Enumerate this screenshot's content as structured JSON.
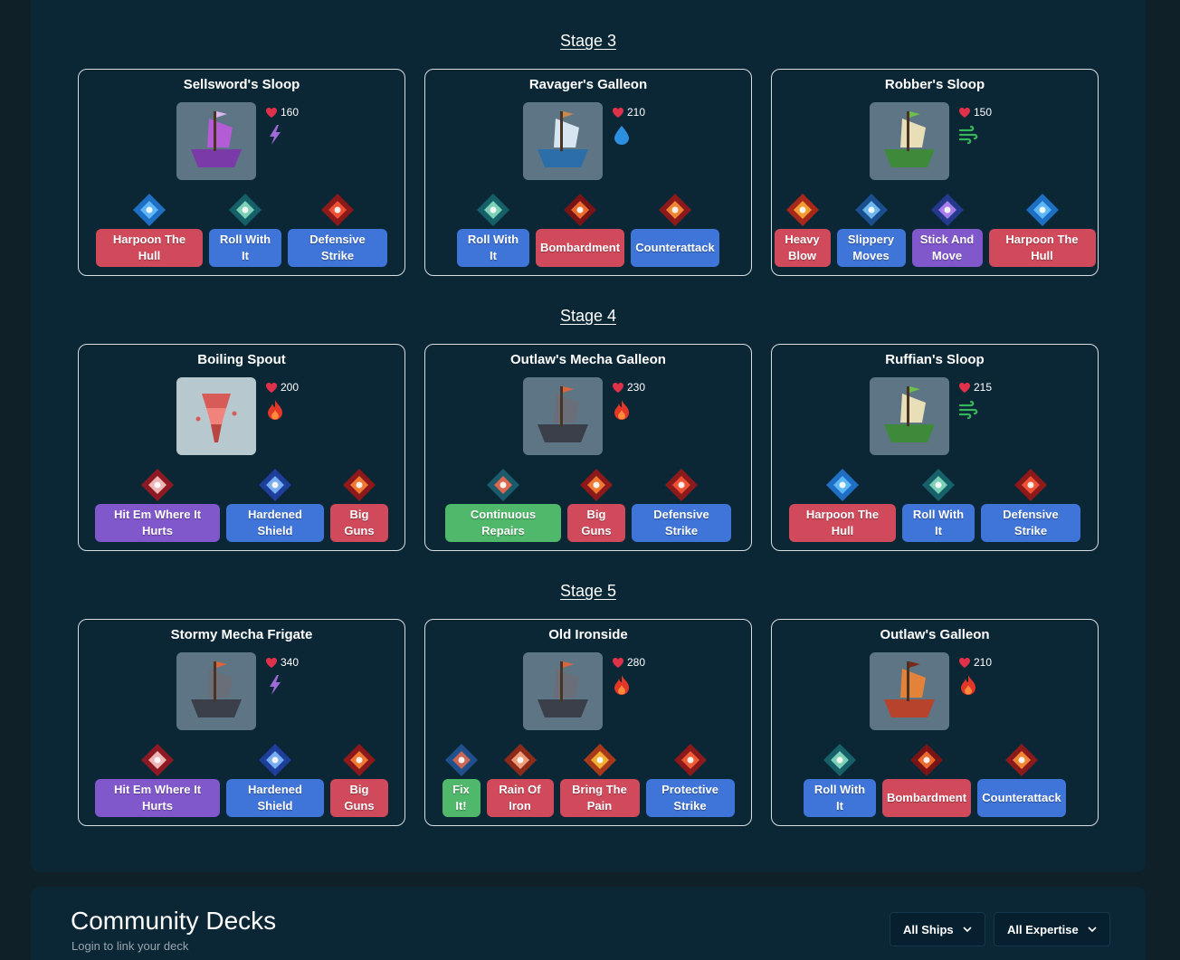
{
  "stages": [
    {
      "title": "Stage 3",
      "ships": [
        {
          "name": "Sellsword's Sloop",
          "hp": "160",
          "element": "lightning-icon",
          "theme": "purple",
          "skills": [
            {
              "label": "Harpoon The Hull",
              "color": "red",
              "icon": "harpoon-icon"
            },
            {
              "label": "Roll With It",
              "color": "blue",
              "icon": "roll-icon"
            },
            {
              "label": "Defensive Strike",
              "color": "blue",
              "icon": "defensive-strike-icon"
            }
          ]
        },
        {
          "name": "Ravager's Galleon",
          "hp": "210",
          "element": "water-icon",
          "theme": "blue",
          "skills": [
            {
              "label": "Roll With It",
              "color": "blue",
              "icon": "roll-icon"
            },
            {
              "label": "Bombardment",
              "color": "red",
              "icon": "bombardment-icon"
            },
            {
              "label": "Counterattack",
              "color": "blue",
              "icon": "counterattack-icon"
            }
          ]
        },
        {
          "name": "Robber's Sloop",
          "hp": "150",
          "element": "wind-icon",
          "theme": "green",
          "skills": [
            {
              "label": "Heavy Blow",
              "color": "red",
              "icon": "heavy-blow-icon"
            },
            {
              "label": "Slippery Moves",
              "color": "blue",
              "icon": "slippery-icon"
            },
            {
              "label": "Stick And Move",
              "color": "purple",
              "icon": "stick-move-icon"
            },
            {
              "label": "Harpoon The Hull",
              "color": "red",
              "icon": "harpoon-icon"
            }
          ]
        }
      ]
    },
    {
      "title": "Stage 4",
      "ships": [
        {
          "name": "Boiling Spout",
          "hp": "200",
          "element": "fire-icon",
          "theme": "spout",
          "skills": [
            {
              "label": "Hit Em Where It Hurts",
              "color": "purple",
              "icon": "hit-em-icon"
            },
            {
              "label": "Hardened Shield",
              "color": "blue",
              "icon": "shield-icon"
            },
            {
              "label": "Big Guns",
              "color": "red",
              "icon": "big-guns-icon"
            }
          ]
        },
        {
          "name": "Outlaw's Mecha Galleon",
          "hp": "230",
          "element": "fire-icon",
          "theme": "mecha",
          "skills": [
            {
              "label": "Continuous Repairs",
              "color": "green",
              "icon": "repairs-icon"
            },
            {
              "label": "Big Guns",
              "color": "red",
              "icon": "big-guns-icon"
            },
            {
              "label": "Defensive Strike",
              "color": "blue",
              "icon": "defensive-strike-icon"
            }
          ]
        },
        {
          "name": "Ruffian's Sloop",
          "hp": "215",
          "element": "wind-icon",
          "theme": "green",
          "skills": [
            {
              "label": "Harpoon The Hull",
              "color": "red",
              "icon": "harpoon-icon"
            },
            {
              "label": "Roll With It",
              "color": "blue",
              "icon": "roll-icon"
            },
            {
              "label": "Defensive Strike",
              "color": "blue",
              "icon": "defensive-strike-icon"
            }
          ]
        }
      ]
    },
    {
      "title": "Stage 5",
      "ships": [
        {
          "name": "Stormy Mecha Frigate",
          "hp": "340",
          "element": "lightning-icon",
          "theme": "mecha",
          "skills": [
            {
              "label": "Hit Em Where It Hurts",
              "color": "purple",
              "icon": "hit-em-icon"
            },
            {
              "label": "Hardened Shield",
              "color": "blue",
              "icon": "shield-icon"
            },
            {
              "label": "Big Guns",
              "color": "red",
              "icon": "big-guns-icon"
            }
          ]
        },
        {
          "name": "Old Ironside",
          "hp": "280",
          "element": "fire-icon",
          "theme": "mecha",
          "skills": [
            {
              "label": "Fix It!",
              "color": "green",
              "icon": "fix-it-icon"
            },
            {
              "label": "Rain Of Iron",
              "color": "red",
              "icon": "rain-iron-icon"
            },
            {
              "label": "Bring The Pain",
              "color": "red",
              "icon": "bring-pain-icon"
            },
            {
              "label": "Protective Strike",
              "color": "blue",
              "icon": "protective-strike-icon"
            }
          ]
        },
        {
          "name": "Outlaw's Galleon",
          "hp": "210",
          "element": "fire-icon",
          "theme": "red",
          "skills": [
            {
              "label": "Roll With It",
              "color": "blue",
              "icon": "roll-icon"
            },
            {
              "label": "Bombardment",
              "color": "red",
              "icon": "bombardment-icon"
            },
            {
              "label": "Counterattack",
              "color": "blue",
              "icon": "counterattack-icon"
            }
          ]
        }
      ]
    }
  ],
  "community": {
    "title": "Community Decks",
    "subtitle": "Login to link your deck",
    "filter_ships": "All Ships",
    "filter_expertise": "All Expertise"
  },
  "colors": {
    "red": "#d14a5b",
    "blue": "#3f74d8",
    "purple": "#8157cc",
    "green": "#4fb86a"
  }
}
